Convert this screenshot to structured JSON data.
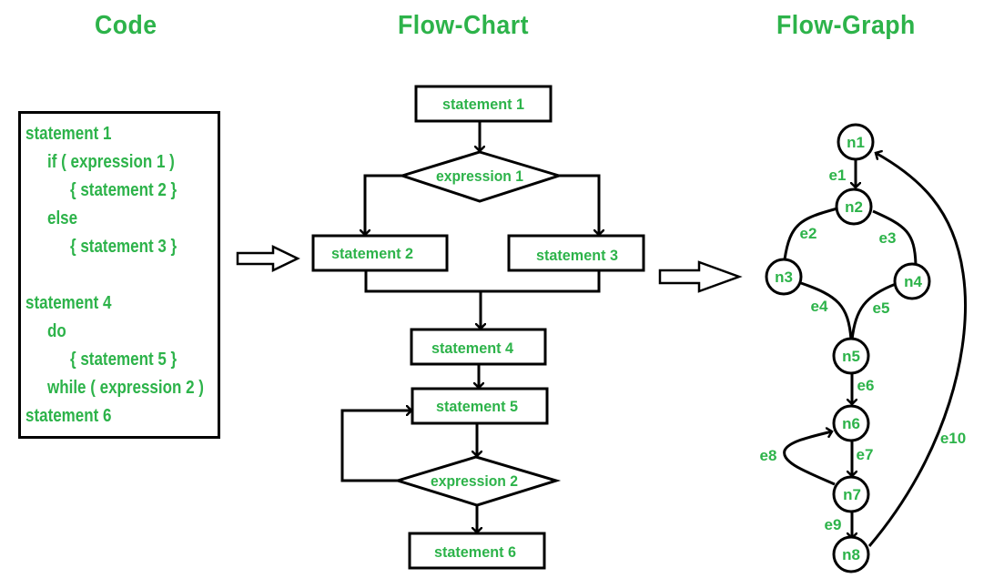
{
  "titles": {
    "code": "Code",
    "flowchart": "Flow-Chart",
    "flowgraph": "Flow-Graph"
  },
  "code": {
    "lines": [
      {
        "text": "statement 1",
        "indent": 0
      },
      {
        "text": "if ( expression 1 )",
        "indent": 1
      },
      {
        "text": "{ statement 2 }",
        "indent": 2
      },
      {
        "text": "else",
        "indent": 1
      },
      {
        "text": "{ statement 3 }",
        "indent": 2
      },
      {
        "text": "",
        "indent": 0
      },
      {
        "text": "statement 4",
        "indent": 0
      },
      {
        "text": "do",
        "indent": 1
      },
      {
        "text": "{ statement 5 }",
        "indent": 2
      },
      {
        "text": "while ( expression 2 )",
        "indent": 1
      },
      {
        "text": "statement 6",
        "indent": 0
      }
    ]
  },
  "flowchart": {
    "nodes": {
      "s1": "statement 1",
      "x1": "expression 1",
      "s2": "statement 2",
      "s3": "statement 3",
      "s4": "statement 4",
      "s5": "statement 5",
      "x2": "expression 2",
      "s6": "statement 6"
    }
  },
  "flowgraph": {
    "nodes": [
      "n1",
      "n2",
      "n3",
      "n4",
      "n5",
      "n6",
      "n7",
      "n8"
    ],
    "edges": [
      {
        "label": "e1",
        "from": "n1",
        "to": "n2"
      },
      {
        "label": "e2",
        "from": "n2",
        "to": "n3"
      },
      {
        "label": "e3",
        "from": "n2",
        "to": "n4"
      },
      {
        "label": "e4",
        "from": "n3",
        "to": "n5"
      },
      {
        "label": "e5",
        "from": "n4",
        "to": "n5"
      },
      {
        "label": "e6",
        "from": "n5",
        "to": "n6"
      },
      {
        "label": "e7",
        "from": "n6",
        "to": "n7"
      },
      {
        "label": "e8",
        "from": "n7",
        "to": "n6"
      },
      {
        "label": "e9",
        "from": "n7",
        "to": "n8"
      },
      {
        "label": "e10",
        "from": "n8",
        "to": "n1"
      }
    ]
  },
  "colors": {
    "accent": "#2db34a",
    "stroke": "#000000"
  }
}
